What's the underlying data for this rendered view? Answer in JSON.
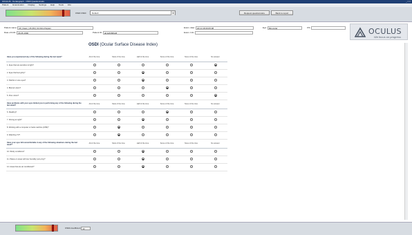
{
  "window": {
    "title": "OCULUS - Keratograph - OSDI Questionnaire",
    "controls": "_ □ ×"
  },
  "menu": [
    "Patient",
    "Examination",
    "Display",
    "Settings",
    "Help",
    "Tools",
    "Info"
  ],
  "toolbar": {
    "osdi_label": "OSDI OSDI",
    "osdi_select_value": "Default",
    "btn_questionnaire": "Request questionnaire",
    "btn_back": "Back to report"
  },
  "patient": {
    "name_label": "Patient name:",
    "name_value": "Mr_Dean_US (84), Dr-Rico Papam",
    "dob_label": "Date of birth:",
    "dob_value": "06.05.1990",
    "pid_label": "Patient ID:",
    "pid_value": "ab4e6b80fa9f",
    "exam_date_label": "Exam. date:",
    "exam_date_value": "18.10.18 09:05:08",
    "exam_info_label": "Exam. Info:",
    "eye_label": "Eye:",
    "eye_value": "Binocular",
    "os_label": "OS:"
  },
  "logo": {
    "name": "OCULUS",
    "slogan": "We focus on progress"
  },
  "form": {
    "title_bold": "OSDI",
    "title_rest": "(Ocular Surface Disease Index)",
    "columns": [
      "All of the time",
      "Most of the time",
      "Half of the time",
      "Some of the time",
      "None of the time",
      "No answer"
    ],
    "sections": [
      {
        "header": "Have you experienced any of the following during the last week?",
        "questions": [
          {
            "text": "1. Eyes that are sensitive to light?",
            "selected": 5
          },
          {
            "text": "2. Eyes that feel gritty?",
            "selected": 2
          },
          {
            "text": "3. Painful or sore eyes?",
            "selected": 2
          },
          {
            "text": "4. Blurred vision?",
            "selected": 3
          },
          {
            "text": "5. Poor vision?",
            "selected": 5
          }
        ]
      },
      {
        "header": "Have problems with your eyes limited you in performing any of the following during the last week?",
        "questions": [
          {
            "text": "6. Reading?",
            "selected": 3
          },
          {
            "text": "7. Driving at night?",
            "selected": 2
          },
          {
            "text": "8. Working with a computer or bank machine (ATM)?",
            "selected": 1
          },
          {
            "text": "9. Watching TV?",
            "selected": 1
          }
        ]
      },
      {
        "header": "Have your eyes felt uncomfortable in any of the following situations during the last week?",
        "questions": [
          {
            "text": "10. Windy conditions?",
            "selected": 2
          },
          {
            "text": "11. Places or areas with low humidity (very dry)?",
            "selected": 2
          },
          {
            "text": "12. Areas that are air conditioned?",
            "selected": 2
          }
        ]
      }
    ]
  },
  "footer": {
    "coeff_label": "OSDI-Coefficient",
    "coeff_value": "42"
  },
  "score": {
    "marker_fraction": 0.9
  },
  "colors": {
    "bar_green": "#7fe08a",
    "bar_orange": "#f2b45a",
    "bar_red": "#e35a44",
    "marker": "#c21e14"
  }
}
